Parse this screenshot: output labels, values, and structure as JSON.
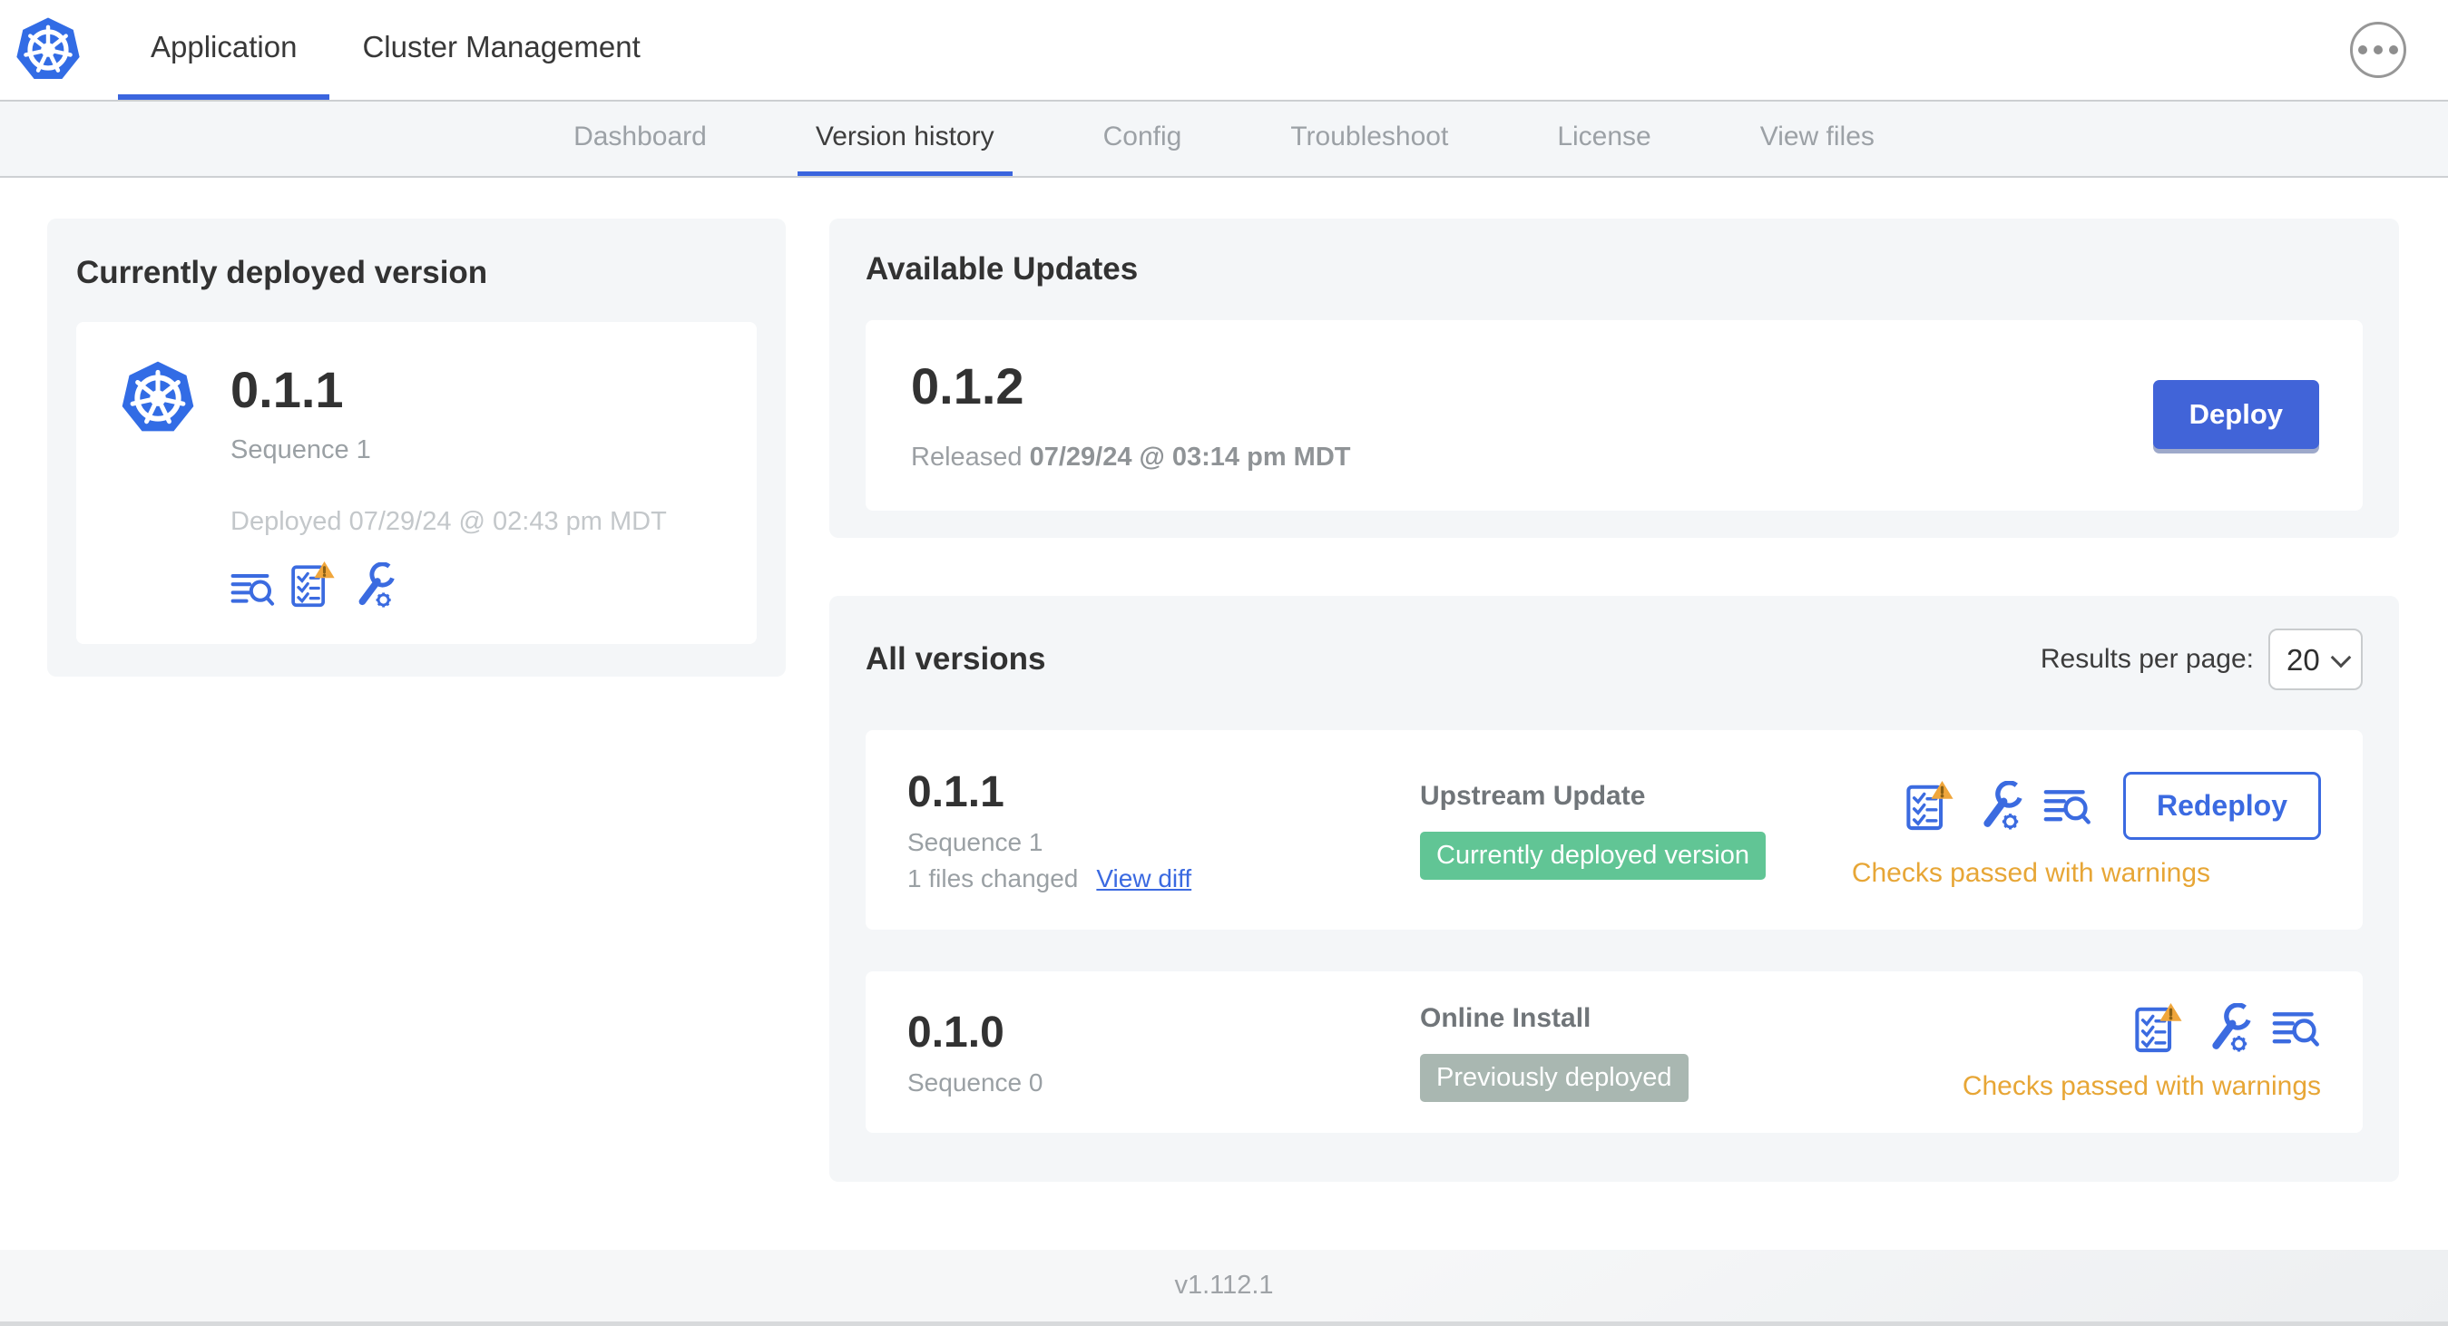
{
  "header": {
    "logo": "kubernetes-logo",
    "tabs": [
      {
        "label": "Application",
        "active": true
      },
      {
        "label": "Cluster Management",
        "active": false
      }
    ],
    "more_button_icon": "ellipsis-icon"
  },
  "subnav": {
    "active": "Version history",
    "tabs": [
      "Dashboard",
      "Version history",
      "Config",
      "Troubleshoot",
      "License",
      "View files"
    ]
  },
  "current_version_card": {
    "title": "Currently deployed version",
    "version": "0.1.1",
    "sequence": "Sequence 1",
    "deployed": "Deployed 07/29/24 @ 02:43 pm MDT",
    "icons": [
      "view-diff-logs-icon",
      "preflight-checks-warning-icon",
      "config-wrench-icon"
    ]
  },
  "available_updates_card": {
    "title": "Available Updates",
    "version": "0.1.2",
    "released_prefix": "Released",
    "released_date": "07/29/24 @ 03:14 pm MDT",
    "deploy_label": "Deploy"
  },
  "all_versions_card": {
    "title": "All versions",
    "results_per_page_label": "Results per page:",
    "results_per_page_value": "20",
    "rows": [
      {
        "version": "0.1.1",
        "sequence": "Sequence 1",
        "files_changed": "1 files changed",
        "view_diff_label": "View diff",
        "source": "Upstream Update",
        "badge": "Currently deployed version",
        "badge_color": "#61c595",
        "icons": [
          "preflight-checks-warning-icon",
          "config-wrench-icon",
          "view-diff-logs-icon"
        ],
        "action_label": "Redeploy",
        "status": "Checks passed with warnings",
        "status_color": "#e7a636"
      },
      {
        "version": "0.1.0",
        "sequence": "Sequence 0",
        "source": "Online Install",
        "badge": "Previously deployed",
        "badge_color": "#a9b7b1",
        "icons": [
          "preflight-checks-warning-icon",
          "config-wrench-icon",
          "view-diff-logs-icon"
        ],
        "status": "Checks passed with warnings",
        "status_color": "#e7a636"
      }
    ]
  },
  "footer": {
    "app_version": "v1.112.1"
  },
  "colors": {
    "accent_blue": "#3b65de",
    "button_blue": "#4164d8",
    "kubernetes_blue": "#326ce5",
    "badge_green": "#61c595",
    "badge_gray": "#a9b7b1",
    "warning_orange": "#e7a636",
    "panel_gray": "#f4f6f8"
  }
}
